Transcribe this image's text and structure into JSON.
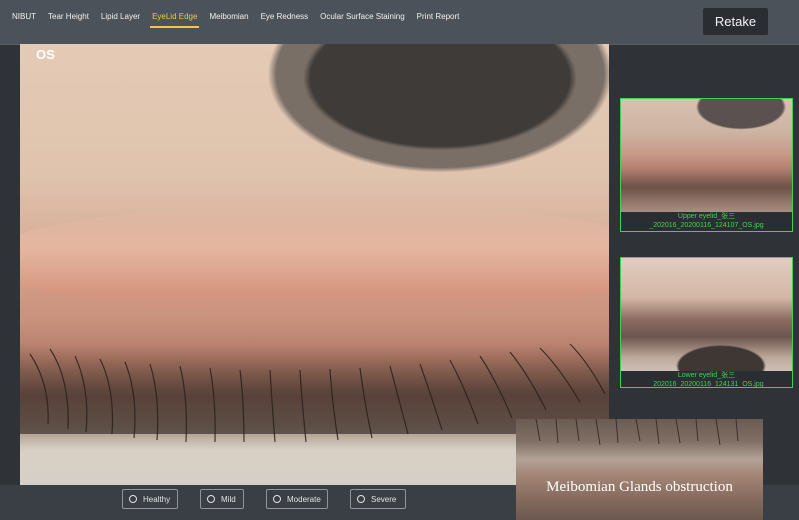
{
  "tabs": [
    {
      "label": "NIBUT",
      "active": false
    },
    {
      "label": "Tear Height",
      "active": false
    },
    {
      "label": "Lipid Layer",
      "active": false
    },
    {
      "label": "EyeLid Edge",
      "active": true
    },
    {
      "label": "Meibomian",
      "active": false
    },
    {
      "label": "Eye Redness",
      "active": false
    },
    {
      "label": "Ocular Surface Staining",
      "active": false
    },
    {
      "label": "Print Report",
      "active": false
    }
  ],
  "retake_label": "Retake",
  "main_view": {
    "eye_label": "OS"
  },
  "thumbnails": [
    {
      "caption": "Upper eyelid_张三_202016_20200116_124107_OS.jpg"
    },
    {
      "caption": "Lower eyelid_张三_202016_20200116_124131_OS.jpg"
    }
  ],
  "overlay_text": "Meibomian Glands obstruction",
  "grades": [
    "Healthy",
    "Mild",
    "Moderate",
    "Severe"
  ],
  "colors": {
    "accent": "#f2c54b",
    "thumb_border": "#3fd14f",
    "caption": "#46d255"
  }
}
